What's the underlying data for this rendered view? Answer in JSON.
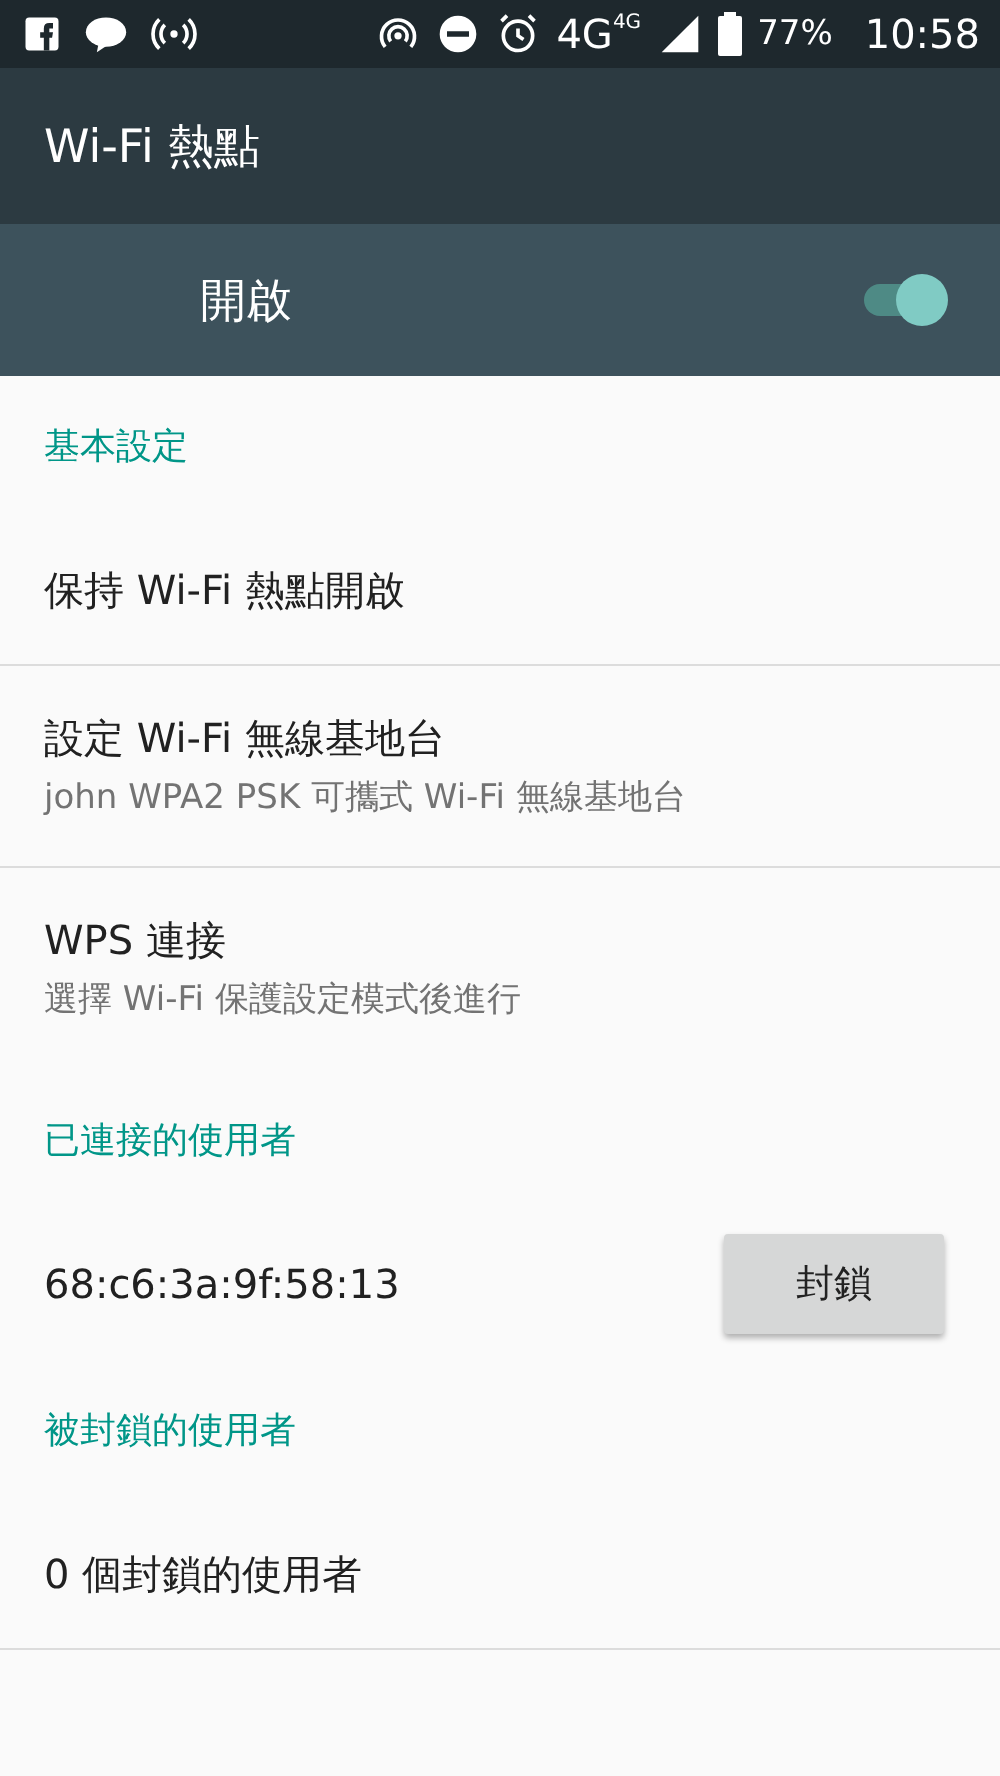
{
  "status_bar": {
    "network": "4G",
    "network_badge": "4G",
    "battery": "77%",
    "time": "10:58"
  },
  "toolbar": {
    "title": "Wi-Fi 熱點"
  },
  "master_switch": {
    "label": "開啟",
    "on": true
  },
  "sections": [
    {
      "header": "基本設定",
      "items": [
        {
          "kind": "pref",
          "title": "保持 Wi-Fi 熱點開啟"
        },
        {
          "kind": "pref",
          "title": "設定 Wi-Fi 無線基地台",
          "subtitle": "john WPA2 PSK 可攜式 Wi-Fi 無線基地台"
        },
        {
          "kind": "pref",
          "title": "WPS 連接",
          "subtitle": "選擇 Wi-Fi 保護設定模式後進行"
        }
      ]
    },
    {
      "header": "已連接的使用者",
      "items": [
        {
          "kind": "client",
          "title": "68:c6:3a:9f:58:13",
          "button": "封鎖"
        }
      ]
    },
    {
      "header": "被封鎖的使用者",
      "items": [
        {
          "kind": "pref",
          "title": "0 個封鎖的使用者"
        }
      ]
    }
  ]
}
